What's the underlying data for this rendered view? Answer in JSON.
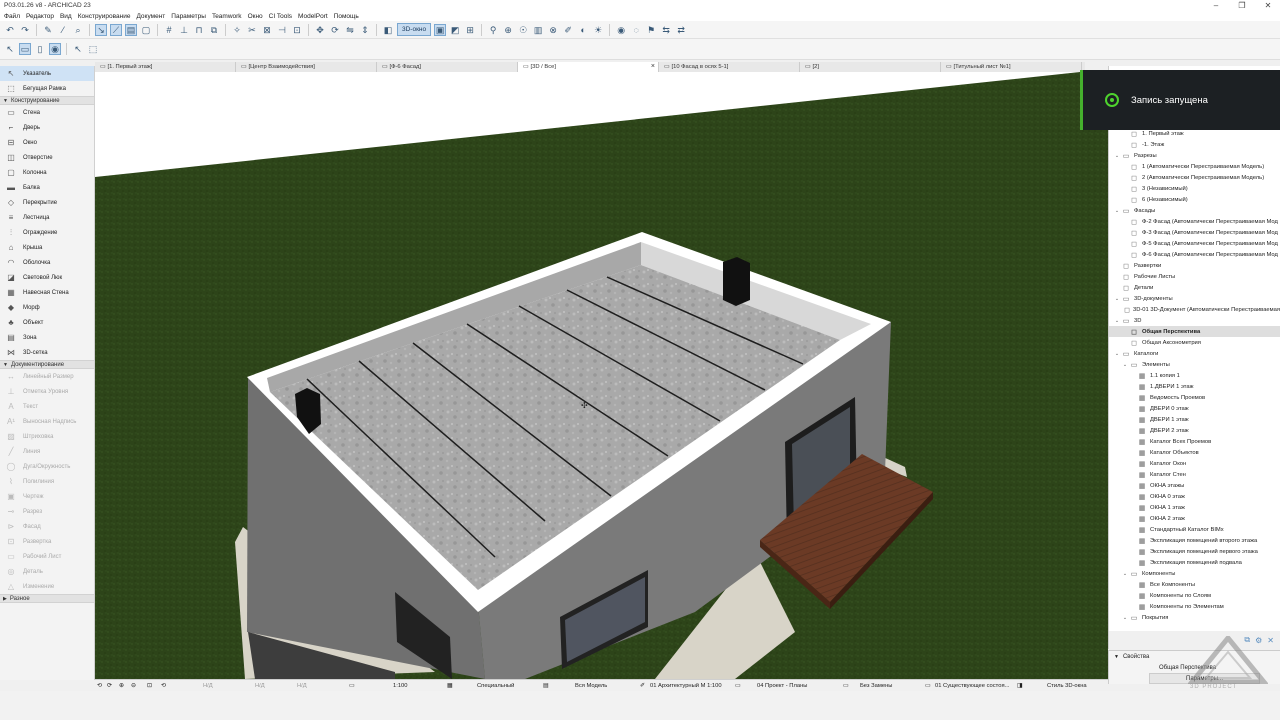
{
  "window": {
    "title": "Р03.01.26 v8 - ARCHICAD 23",
    "controls": [
      "–",
      "❐",
      "✕"
    ]
  },
  "menu": [
    "Файл",
    "Редактор",
    "Вид",
    "Конструирование",
    "Документ",
    "Параметры",
    "Teamwork",
    "Окно",
    "CI Tools",
    "ModelPort",
    "Помощь"
  ],
  "toolbar": {
    "view_3d_label": "3D-окно"
  },
  "toolbox": {
    "pointer": "Указатель",
    "marquee": "Бегущая Рамка",
    "cat_design": "Конструирование",
    "design_tools": [
      {
        "label": "Стена",
        "icon": "wall-icon",
        "glyph": "▭"
      },
      {
        "label": "Дверь",
        "icon": "door-icon",
        "glyph": "⌐"
      },
      {
        "label": "Окно",
        "icon": "window-icon",
        "glyph": "⊟"
      },
      {
        "label": "Отверстие",
        "icon": "opening-icon",
        "glyph": "◫"
      },
      {
        "label": "Колонна",
        "icon": "column-icon",
        "glyph": "▢"
      },
      {
        "label": "Балка",
        "icon": "beam-icon",
        "glyph": "▬"
      },
      {
        "label": "Перекрытие",
        "icon": "slab-icon",
        "glyph": "◇"
      },
      {
        "label": "Лестница",
        "icon": "stair-icon",
        "glyph": "≡"
      },
      {
        "label": "Ограждение",
        "icon": "railing-icon",
        "glyph": "⫶"
      },
      {
        "label": "Крыша",
        "icon": "roof-icon",
        "glyph": "⌂"
      },
      {
        "label": "Оболочка",
        "icon": "shell-icon",
        "glyph": "◠"
      },
      {
        "label": "Световой Люк",
        "icon": "skylight-icon",
        "glyph": "◪"
      },
      {
        "label": "Навесная Стена",
        "icon": "curtain-wall-icon",
        "glyph": "▦"
      },
      {
        "label": "Морф",
        "icon": "morph-icon",
        "glyph": "◆"
      },
      {
        "label": "Объект",
        "icon": "object-icon",
        "glyph": "♣"
      },
      {
        "label": "Зона",
        "icon": "zone-icon",
        "glyph": "▤"
      },
      {
        "label": "3D-сетка",
        "icon": "mesh-icon",
        "glyph": "⋈"
      }
    ],
    "cat_document": "Документирование",
    "document_tools": [
      {
        "label": "Линейный Размер",
        "icon": "dimension-icon",
        "glyph": "↔"
      },
      {
        "label": "Отметка Уровня",
        "icon": "level-icon",
        "glyph": "⊥"
      },
      {
        "label": "Текст",
        "icon": "text-icon",
        "glyph": "A"
      },
      {
        "label": "Выносная Надпись",
        "icon": "label-icon",
        "glyph": "A¹"
      },
      {
        "label": "Штриховка",
        "icon": "fill-icon",
        "glyph": "▨"
      },
      {
        "label": "Линия",
        "icon": "line-icon",
        "glyph": "╱"
      },
      {
        "label": "Дуга/Окружность",
        "icon": "arc-icon",
        "glyph": "◯"
      },
      {
        "label": "Полилиния",
        "icon": "polyline-icon",
        "glyph": "⌇"
      },
      {
        "label": "Чертеж",
        "icon": "drawing-icon",
        "glyph": "▣"
      },
      {
        "label": "Разрез",
        "icon": "section-icon",
        "glyph": "⊸"
      },
      {
        "label": "Фасад",
        "icon": "elevation-icon",
        "glyph": "⊳"
      },
      {
        "label": "Развертка",
        "icon": "interior-elevation-icon",
        "glyph": "⊡"
      },
      {
        "label": "Рабочий Лист",
        "icon": "worksheet-icon",
        "glyph": "▭"
      },
      {
        "label": "Деталь",
        "icon": "detail-icon",
        "glyph": "◎"
      },
      {
        "label": "Изменение",
        "icon": "change-icon",
        "glyph": "△"
      }
    ],
    "cat_more": "Разное"
  },
  "tabs": [
    {
      "label": "[1. Первый этаж]",
      "icon": "floor-plan-icon"
    },
    {
      "label": "[Центр Взаимодействия]",
      "icon": "collaboration-icon"
    },
    {
      "label": "[Ф-6 Фасад]",
      "icon": "elevation-icon"
    },
    {
      "label": "[3D / Все]",
      "icon": "3d-icon"
    },
    {
      "label": "[10 Фасад в осях 5-1]",
      "icon": "elevation-icon"
    },
    {
      "label": "[2]",
      "icon": "section-icon"
    },
    {
      "label": "[Титульный лист №1]",
      "icon": "layout-icon"
    }
  ],
  "notification": {
    "text": "Запись запущена"
  },
  "navigator": [
    {
      "label": "1. Первый этаж",
      "indent": 2
    },
    {
      "label": "-1. Этаж",
      "indent": 2
    },
    {
      "label": "Разрезы",
      "indent": 1,
      "tri": "⌄"
    },
    {
      "label": "1 (Автоматически Перестраиваемая Модель)",
      "indent": 2
    },
    {
      "label": "2 (Автоматически Перестраиваемая Модель)",
      "indent": 2
    },
    {
      "label": "3 (Независимый)",
      "indent": 2
    },
    {
      "label": "6 (Независимый)",
      "indent": 2
    },
    {
      "label": "Фасады",
      "indent": 1,
      "tri": "⌄"
    },
    {
      "label": "Ф-2 Фасад (Автоматически Перестраиваемая Мод",
      "indent": 2
    },
    {
      "label": "Ф-3 Фасад (Автоматически Перестраиваемая Мод",
      "indent": 2
    },
    {
      "label": "Ф-5 Фасад (Автоматически Перестраиваемая Мод",
      "indent": 2
    },
    {
      "label": "Ф-6 Фасад (Автоматически Перестраиваемая Мод",
      "indent": 2
    },
    {
      "label": "Развертки",
      "indent": 1
    },
    {
      "label": "Рабочие Листы",
      "indent": 1
    },
    {
      "label": "Детали",
      "indent": 1
    },
    {
      "label": "3D-документы",
      "indent": 1,
      "tri": "⌄"
    },
    {
      "label": "3D-01 3D-Документ (Автоматически Перестраиваемая",
      "indent": 2
    },
    {
      "label": "3D",
      "indent": 1,
      "tri": "⌄"
    },
    {
      "label": "Общая Перспектива",
      "indent": 2,
      "selected": true
    },
    {
      "label": "Общая Аксонометрия",
      "indent": 2
    },
    {
      "label": "Каталоги",
      "indent": 1,
      "tri": "⌄"
    },
    {
      "label": "Элементы",
      "indent": 2,
      "tri": "⌄"
    },
    {
      "label": "1.1 копия 1",
      "indent": 3
    },
    {
      "label": "1.ДВЕРИ 1 этаж",
      "indent": 3
    },
    {
      "label": "Ведомость Проемов",
      "indent": 3
    },
    {
      "label": "ДВЕРИ 0 этаж",
      "indent": 3
    },
    {
      "label": "ДВЕРИ 1 этаж",
      "indent": 3
    },
    {
      "label": "ДВЕРИ 2 этаж",
      "indent": 3
    },
    {
      "label": "Каталог Всех Проемов",
      "indent": 3
    },
    {
      "label": "Каталог Объектов",
      "indent": 3
    },
    {
      "label": "Каталог Окон",
      "indent": 3
    },
    {
      "label": "Каталог Стен",
      "indent": 3
    },
    {
      "label": "ОКНА этажы",
      "indent": 3
    },
    {
      "label": "ОКНА 0 этаж",
      "indent": 3
    },
    {
      "label": "ОКНА 1 этаж",
      "indent": 3
    },
    {
      "label": "ОКНА 2 этаж",
      "indent": 3
    },
    {
      "label": "Стандартный Каталог BIMx",
      "indent": 3
    },
    {
      "label": "Экспликация помещений второго этажа",
      "indent": 3
    },
    {
      "label": "Экспликация помещений первого этажа",
      "indent": 3
    },
    {
      "label": "Экспликация помещений подвала",
      "indent": 3
    },
    {
      "label": "Компоненты",
      "indent": 2,
      "tri": "⌄"
    },
    {
      "label": "Все Компоненты",
      "indent": 3
    },
    {
      "label": "Компоненты по Слоям",
      "indent": 3
    },
    {
      "label": "Компоненты по Элементам",
      "indent": 3
    },
    {
      "label": "Покрытия",
      "indent": 2,
      "tri": "⌄"
    }
  ],
  "properties": {
    "header": "Свойства",
    "view_name": "Общая Перспектива",
    "params_button": "Параметры..."
  },
  "statusbar": {
    "nd1": "Н/Д",
    "nd2": "Н/Д",
    "nd3": "Н/Д",
    "scale": "1:100",
    "structure": "Специальный",
    "model": "Вся Модель",
    "pen_set": "01 Архитектурный М 1:100",
    "mvo": "04 Проект - Планы",
    "renovation": "Без Замены",
    "renovation_filter": "01 Существующее состоя...",
    "style": "Стиль 3D-окна"
  },
  "watermark": {
    "text": "3D PROJECT"
  },
  "colors": {
    "grass": "#2d4419",
    "sky": "#ffffff",
    "wall": "#707070",
    "parapet": "#ffffff",
    "deck": "#6b3a25",
    "accent": "#45b02d"
  }
}
